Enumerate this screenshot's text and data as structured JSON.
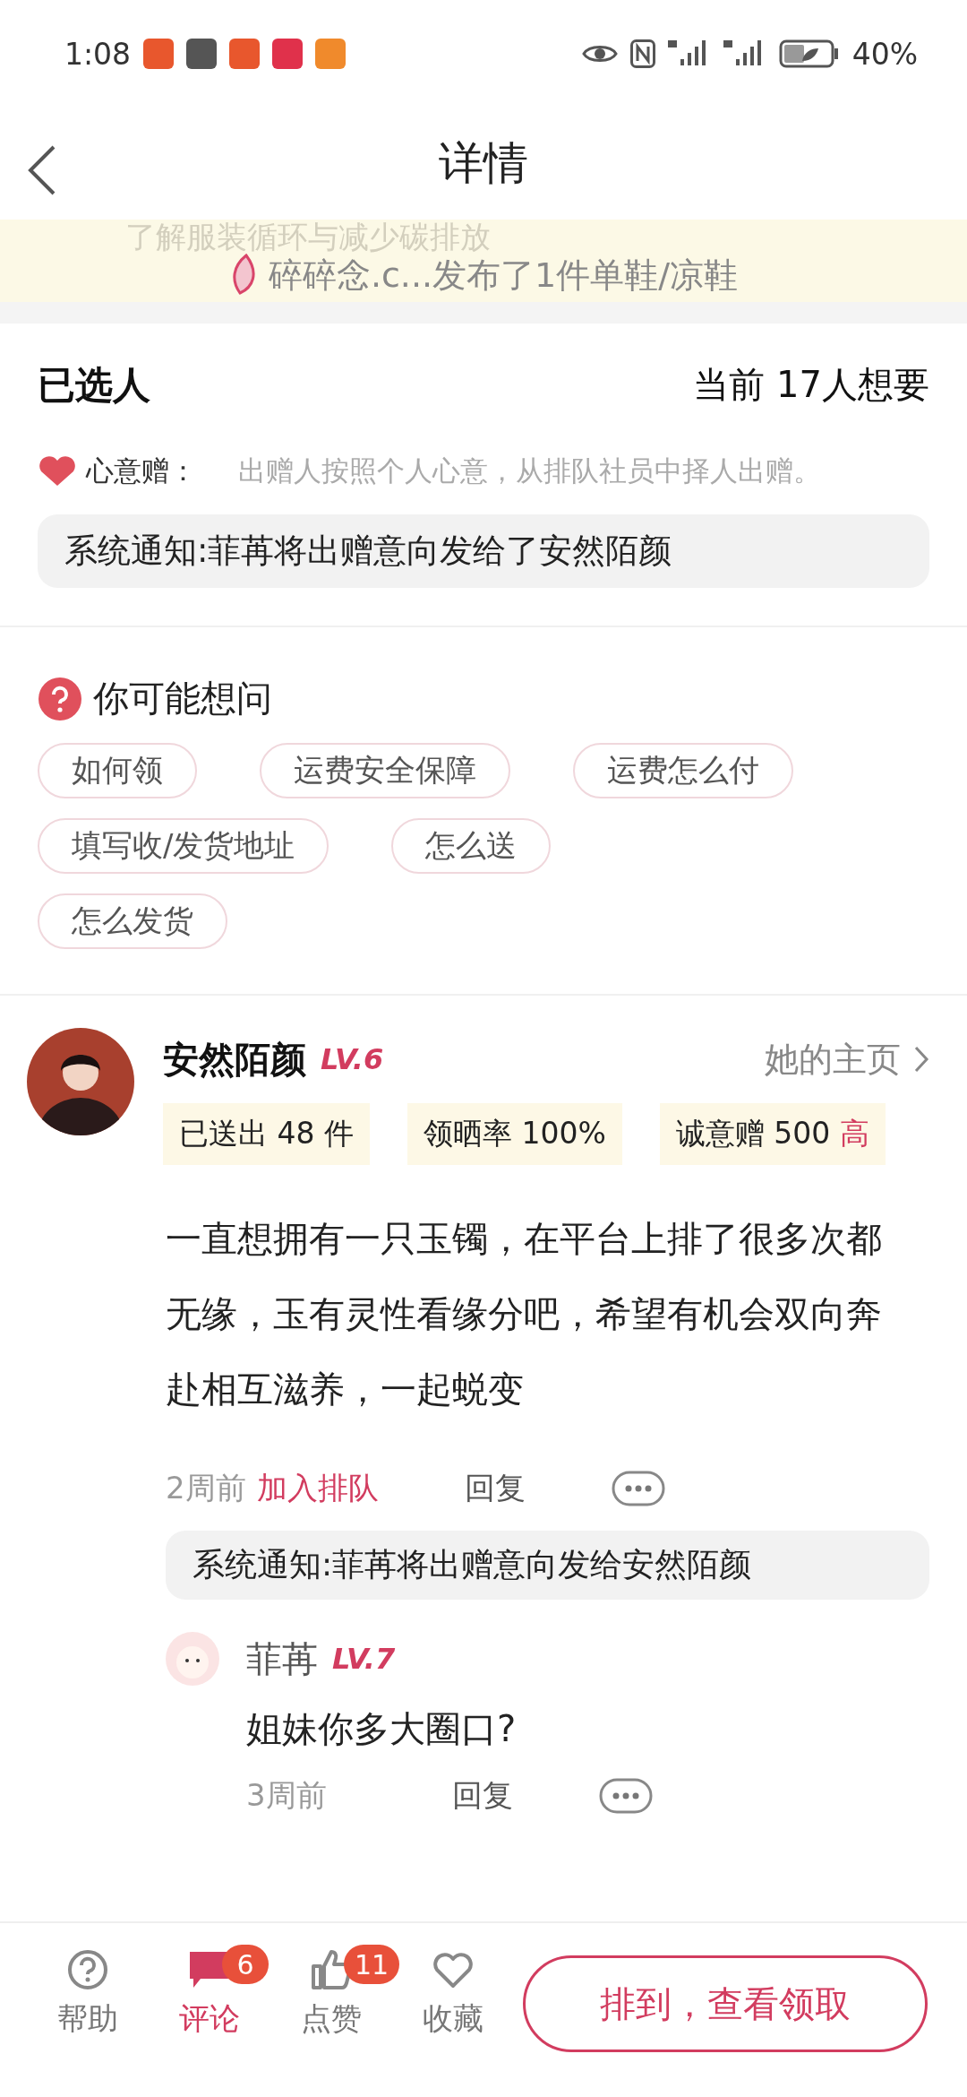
{
  "status_bar": {
    "time": "1:08",
    "battery": "40%"
  },
  "header": {
    "title": "详情"
  },
  "banner": {
    "faded_text": "了解服装循环与减少碳排放",
    "ticker": "碎碎念.c...发布了1件单鞋/凉鞋"
  },
  "selected_section": {
    "title": "已选人",
    "count": "当前 17人想要",
    "mode_label": "心意赠：",
    "mode_desc": "出赠人按照个人心意，从排队社员中择人出赠。",
    "notice": "系统通知:菲苒将出赠意向发给了安然陌颜"
  },
  "questions": {
    "title": "你可能想问",
    "rows": [
      [
        "如何领",
        "运费安全保障",
        "运费怎么付"
      ],
      [
        "填写收/发货地址",
        "怎么送"
      ],
      [
        "怎么发货"
      ]
    ]
  },
  "comment": {
    "user": "安然陌颜",
    "level": "LV.6",
    "homepage": "她的主页",
    "stats": [
      {
        "text": "已送出 48 件"
      },
      {
        "text": "领晒率 100%"
      },
      {
        "text": "诚意赠 500",
        "tag": "高"
      }
    ],
    "text": "一直想拥有一只玉镯，在平台上排了很多次都无缘，玉有灵性看缘分吧，希望有机会双向奔赴相互滋养，一起蜕变",
    "time": "2周前",
    "action": "加入排队",
    "reply": "回复",
    "notice": "系统通知:菲苒将出赠意向发给安然陌颜",
    "replies": [
      {
        "user": "菲苒",
        "level": "LV.7",
        "text": "姐妹你多大圈口?",
        "time": "3周前",
        "reply": "回复"
      }
    ]
  },
  "bottom_bar": {
    "items": [
      {
        "kind": "help",
        "label": "帮助",
        "selected": false
      },
      {
        "kind": "comment",
        "label": "评论",
        "badge": "6",
        "selected": true
      },
      {
        "kind": "like",
        "label": "点赞",
        "badge": "11",
        "selected": false
      },
      {
        "kind": "favorite",
        "label": "收藏",
        "selected": false
      }
    ],
    "action": "排到，查看领取"
  }
}
